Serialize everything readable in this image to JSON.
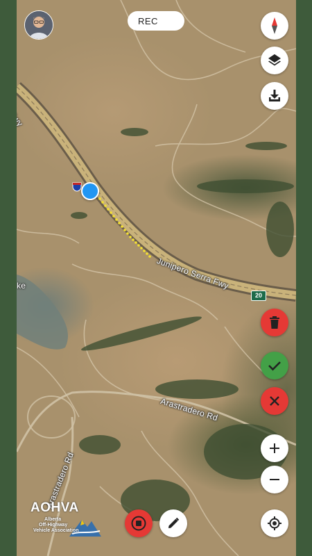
{
  "recorder": {
    "label": "REC"
  },
  "map": {
    "roads": {
      "freeway_top": "Fwy",
      "junipero": "Junipero Serra Fwy",
      "arastradero_east": "Arastradero Rd",
      "arastradero_west": "Arastradero Rd",
      "partial_lake": "ke",
      "route_shield": "20",
      "interstate_shield": "280"
    }
  },
  "logo": {
    "brand": "AOHVA",
    "line1": "Alberta",
    "line2": "Off-Highway",
    "line3": "Vehicle Association"
  },
  "controls": {
    "top": [
      "compass-icon",
      "layers-icon",
      "download-icon"
    ],
    "edit": [
      "trash-icon",
      "check-icon",
      "close-icon"
    ],
    "zoom": [
      "plus-icon",
      "minus-icon"
    ],
    "bottom": [
      "stop-icon",
      "pencil-icon",
      "my-location-icon"
    ]
  },
  "colors": {
    "accent_red": "#e53935",
    "accent_green": "#43a047",
    "location_blue": "#2196f3",
    "track_yellow": "#f5e132"
  }
}
